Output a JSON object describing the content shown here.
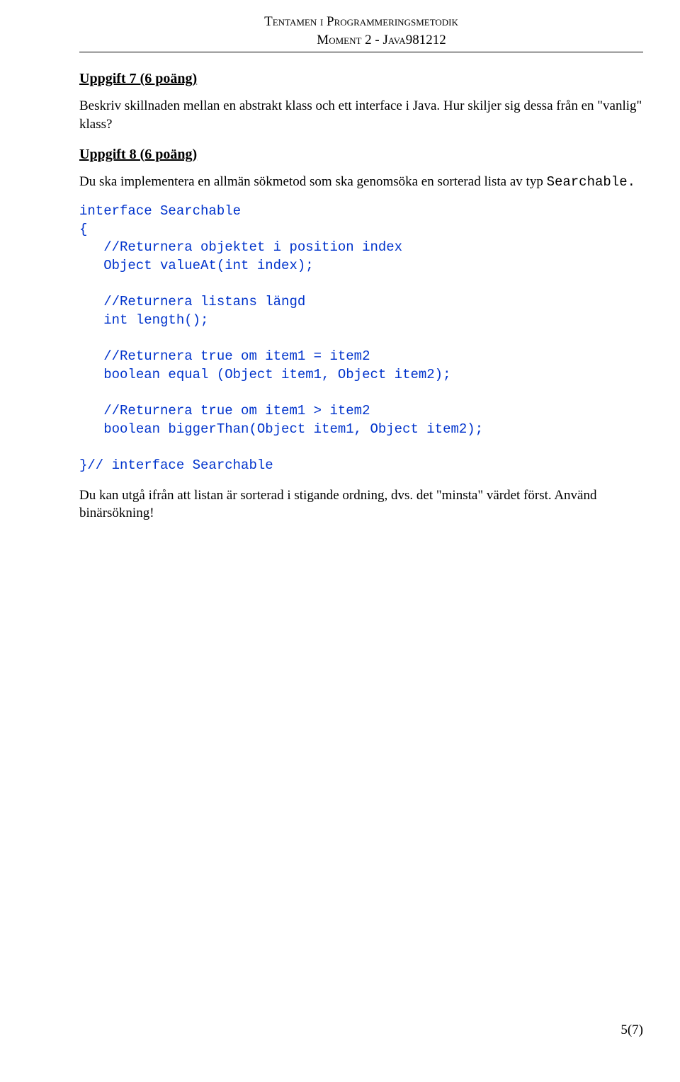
{
  "header": {
    "title_line1": "Tentamen i Programmeringsmetodik",
    "title_line2": "Moment 2 - Java",
    "date": "981212"
  },
  "task7": {
    "heading": "Uppgift 7 (6 poäng)",
    "para": "Beskriv skillnaden mellan en abstrakt klass och ett interface i Java. Hur skiljer sig dessa från en \"vanlig\" klass?"
  },
  "task8": {
    "heading": "Uppgift 8 (6 poäng)",
    "intro_pre": "Du ska implementera en allmän sökmetod som ska genomsöka en sorterad lista av typ ",
    "intro_code": "Searchable.",
    "code": "interface Searchable\n{\n   //Returnera objektet i position index\n   Object valueAt(int index);\n\n   //Returnera listans längd\n   int length();\n\n   //Returnera true om item1 = item2\n   boolean equal (Object item1, Object item2);\n\n   //Returnera true om item1 > item2\n   boolean biggerThan(Object item1, Object item2);\n\n}// interface Searchable",
    "outro": "Du kan utgå ifrån att listan är sorterad i stigande ordning, dvs. det \"minsta\" värdet först. Använd binärsökning!"
  },
  "footer": {
    "page": "5(7)"
  }
}
